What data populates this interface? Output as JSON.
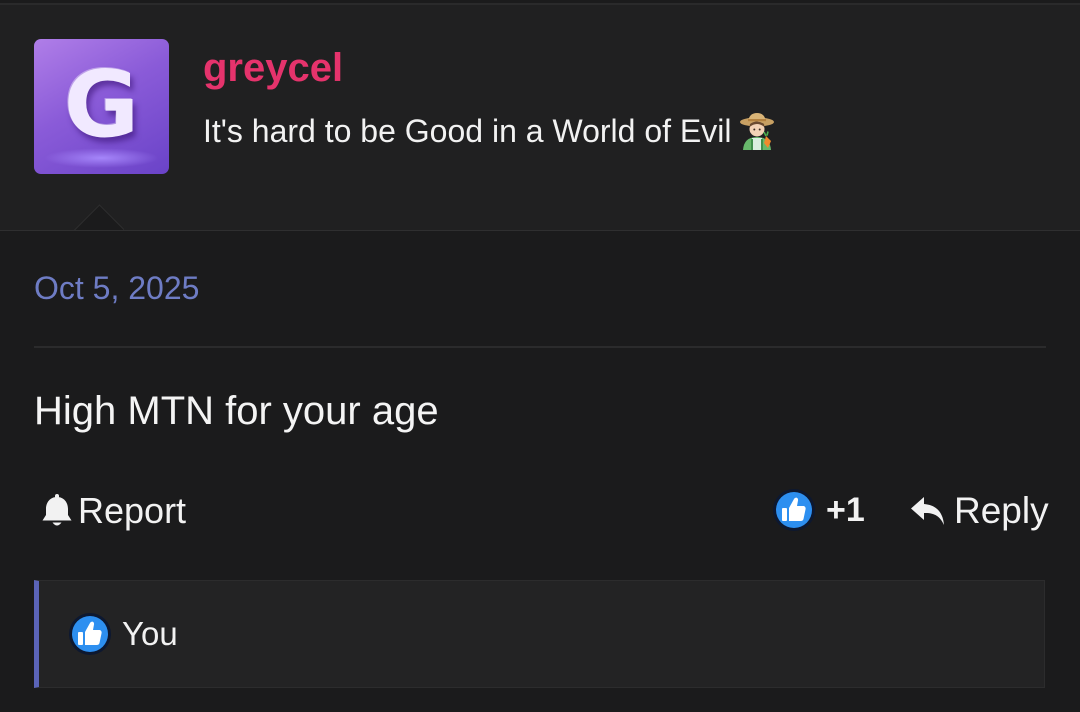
{
  "user": {
    "avatar_letter": "G",
    "username": "greycel",
    "title": "It's hard to be Good in a World of Evil",
    "title_icon": "farmer-emoji"
  },
  "post": {
    "date": "Oct 5, 2025",
    "body": "High MTN for your age"
  },
  "actions": {
    "report_label": "Report",
    "report_icon": "bell-icon",
    "reaction_count": "+1",
    "reaction_icon": "thumbs-up-icon",
    "reply_label": "Reply",
    "reply_icon": "reply-arrow-icon"
  },
  "reactions_bar": {
    "icon": "thumbs-up-icon",
    "users_text": "You"
  },
  "colors": {
    "background": "#1b1b1c",
    "username": "#e5336c",
    "date": "#6e7cc4",
    "like_blue": "#2d8ff0",
    "reactions_accent": "#5b64b8"
  }
}
